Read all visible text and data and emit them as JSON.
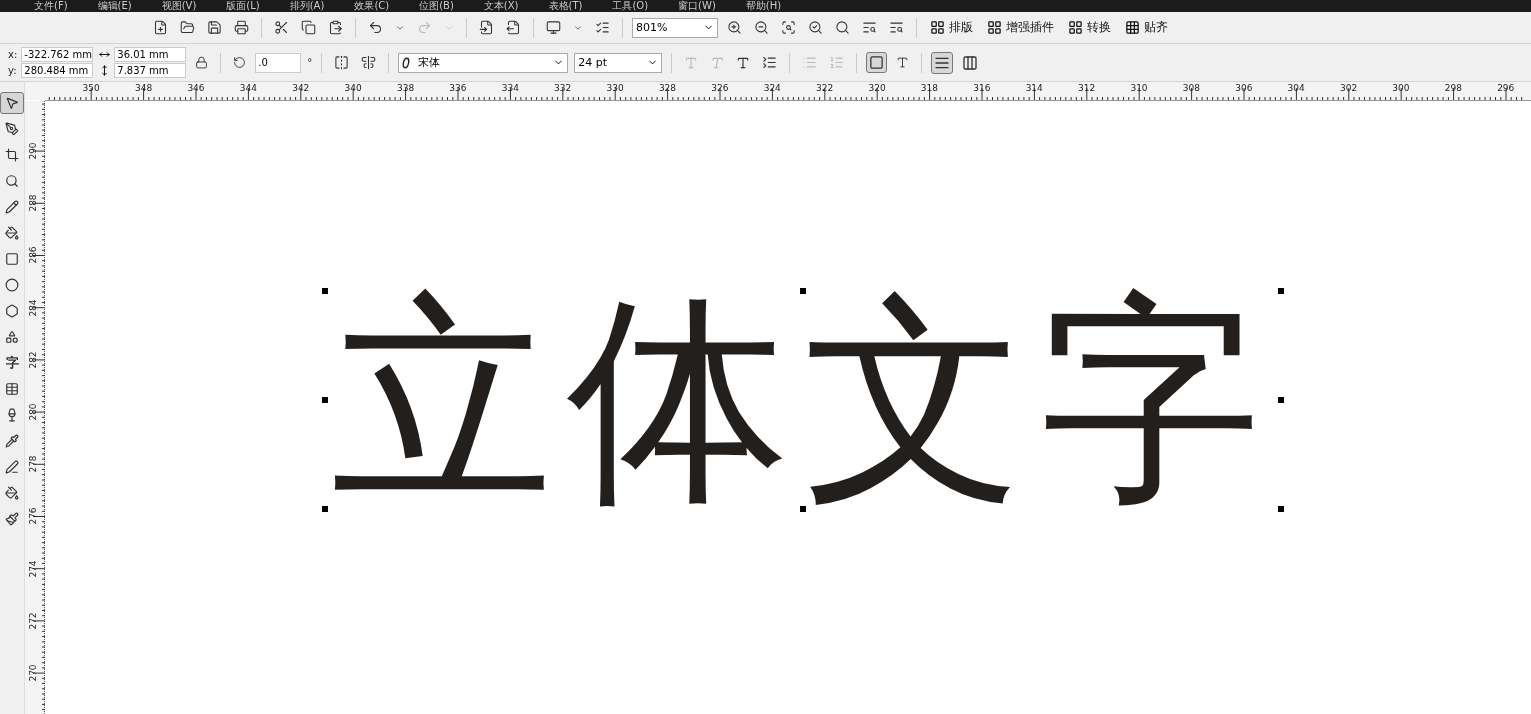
{
  "menu": [
    "文件(F)",
    "编辑(E)",
    "视图(V)",
    "版面(L)",
    "排列(A)",
    "效果(C)",
    "位图(B)",
    "文本(X)",
    "表格(T)",
    "工具(O)",
    "窗口(W)",
    "帮助(H)"
  ],
  "toolbar": {
    "zoom": "801%",
    "buttons": [
      {
        "label": "排版"
      },
      {
        "label": "增强插件"
      },
      {
        "label": "转换"
      },
      {
        "label": "贴齐"
      }
    ]
  },
  "property_bar": {
    "x_label": "x:",
    "x": "-322.762 mm",
    "y_label": "y:",
    "y": "280.484 mm",
    "width": "36.01 mm",
    "height": "7.837 mm",
    "rotation": ".0",
    "degree": "°",
    "font": "宋体",
    "font_size": "24 pt",
    "styles": [
      {
        "kind": "bold",
        "disabled": true
      },
      {
        "kind": "italic",
        "disabled": true
      },
      {
        "kind": "underline",
        "disabled": false
      }
    ],
    "frame_mode": {
      "selected": true
    },
    "orientation": [
      {
        "kind": "horizontal",
        "selected": true
      },
      {
        "kind": "vertical",
        "selected": false
      }
    ]
  },
  "tools": [
    {
      "kind": "pick",
      "selected": true
    },
    {
      "kind": "shape",
      "selected": false
    },
    {
      "kind": "crop",
      "selected": false
    },
    {
      "kind": "zoom",
      "selected": false
    },
    {
      "kind": "freehand",
      "selected": false
    },
    {
      "kind": "smartfill",
      "selected": false
    },
    {
      "kind": "rectangle",
      "selected": false
    },
    {
      "kind": "ellipse",
      "selected": false
    },
    {
      "kind": "polygon",
      "selected": false
    },
    {
      "kind": "shapes",
      "selected": false
    },
    {
      "kind": "text",
      "label": "字",
      "selected": false
    },
    {
      "kind": "table",
      "selected": false
    },
    {
      "kind": "interactive",
      "selected": false
    },
    {
      "kind": "eyedropper",
      "selected": false
    },
    {
      "kind": "outline",
      "selected": false
    },
    {
      "kind": "fill",
      "selected": false
    },
    {
      "kind": "interactivefill",
      "selected": false
    }
  ],
  "ruler_h": [
    "350",
    "348",
    "346",
    "344",
    "342",
    "340",
    "338",
    "336",
    "334",
    "332",
    "330",
    "328",
    "326",
    "324",
    "322",
    "320",
    "318",
    "316",
    "314",
    "312",
    "310",
    "308",
    "306",
    "304",
    "302",
    "300",
    "298",
    "296"
  ],
  "ruler_v": [
    "290",
    "288",
    "286",
    "284",
    "282",
    "280",
    "278",
    "276",
    "274",
    "272",
    "270"
  ],
  "canvas": {
    "text": "立体文字"
  }
}
